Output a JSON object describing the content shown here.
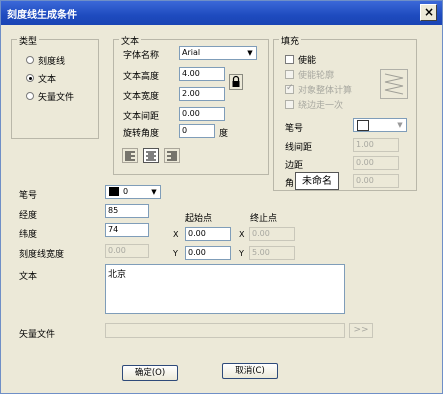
{
  "window": {
    "title": "刻度线生成条件",
    "close_glyph": "×"
  },
  "type_group": {
    "title": "类型",
    "options": [
      "刻度线",
      "文本",
      "矢量文件"
    ],
    "selected_index": 1
  },
  "text_group": {
    "title": "文本",
    "font_name_label": "字体名称",
    "font_name_value": "Arial",
    "height_label": "文本高度",
    "height_value": "4.00",
    "width_label": "文本宽度",
    "width_value": "2.00",
    "spacing_label": "文本间距",
    "spacing_value": "0.00",
    "rotation_label": "旋转角度",
    "rotation_value": "0",
    "rotation_unit": "度",
    "alignment_selected": "center"
  },
  "fill_group": {
    "title": "填充",
    "enable_label": "使能",
    "enable_checked": false,
    "outline_label": "使能轮廓",
    "whole_calc_label": "对象整体计算",
    "whole_calc_checked": true,
    "once_label": "绕边走一次",
    "pen_label": "笔号",
    "line_spacing_label": "线间距",
    "line_spacing_value": "1.00",
    "margin_label": "边距",
    "margin_value": "0.00",
    "angle_label": "角",
    "angle_value": "0.00",
    "tooltip": "未命名"
  },
  "main": {
    "pen_label": "笔号",
    "pen_value": "0",
    "longitude_label": "经度",
    "longitude_value": "85",
    "latitude_label": "纬度",
    "latitude_value": "74",
    "tick_width_label": "刻度线宽度",
    "tick_width_value": "0.00",
    "start_label": "起始点",
    "end_label": "终止点",
    "x_label": "X",
    "y_label": "Y",
    "start_x": "0.00",
    "start_y": "0.00",
    "end_x": "0.00",
    "end_y": "5.00",
    "text_label": "文本",
    "text_value": "北京",
    "vector_file_label": "矢量文件",
    "vector_file_value": "",
    "browse_label": ">>",
    "ok_label": "确定(O)",
    "cancel_label": "取消(C)"
  }
}
